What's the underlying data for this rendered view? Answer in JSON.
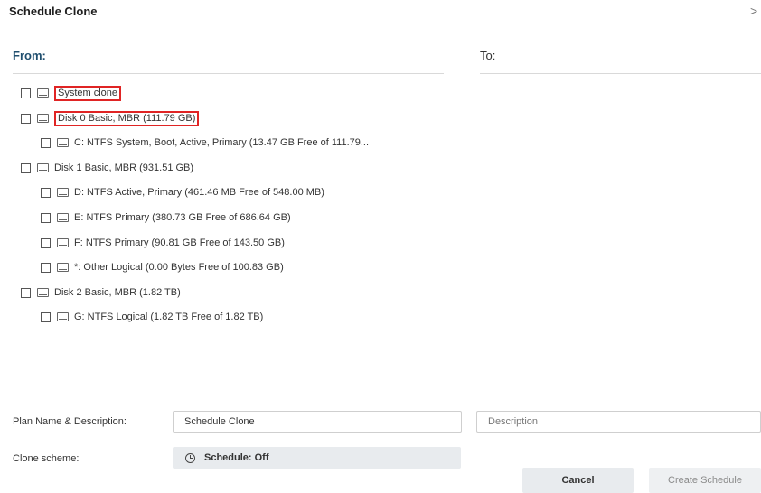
{
  "dialog": {
    "title": "Schedule Clone",
    "close_glyph": ">"
  },
  "from_label": "From:",
  "to_label": "To:",
  "tree": [
    {
      "label": "System clone",
      "level": 0,
      "highlighted": true
    },
    {
      "label": "Disk 0 Basic, MBR (111.79 GB)",
      "level": 0,
      "highlighted": true
    },
    {
      "label": "C: NTFS System, Boot, Active, Primary (13.47 GB Free of 111.79...",
      "level": 1,
      "highlighted": false
    },
    {
      "label": "Disk 1 Basic, MBR (931.51 GB)",
      "level": 0,
      "highlighted": false
    },
    {
      "label": "D: NTFS Active, Primary (461.46 MB Free of 548.00 MB)",
      "level": 1,
      "highlighted": false
    },
    {
      "label": "E: NTFS Primary (380.73 GB Free of 686.64 GB)",
      "level": 1,
      "highlighted": false
    },
    {
      "label": "F: NTFS Primary (90.81 GB Free of 143.50 GB)",
      "level": 1,
      "highlighted": false
    },
    {
      "label": "*: Other Logical (0.00 Bytes Free of 100.83 GB)",
      "level": 1,
      "highlighted": false
    },
    {
      "label": "Disk 2 Basic, MBR (1.82 TB)",
      "level": 0,
      "highlighted": false
    },
    {
      "label": "G: NTFS Logical (1.82 TB Free of 1.82 TB)",
      "level": 1,
      "highlighted": false
    }
  ],
  "plan": {
    "label": "Plan Name & Description:",
    "name_value": "Schedule Clone",
    "description_placeholder": "Description"
  },
  "scheme": {
    "label": "Clone scheme:",
    "schedule_text": "Schedule: Off",
    "icon": "clock-icon"
  },
  "buttons": {
    "cancel": "Cancel",
    "create": "Create Schedule"
  },
  "colors": {
    "highlight": "#e02424",
    "from_label": "#1f4e6e",
    "button_bg": "#e8ebee"
  }
}
